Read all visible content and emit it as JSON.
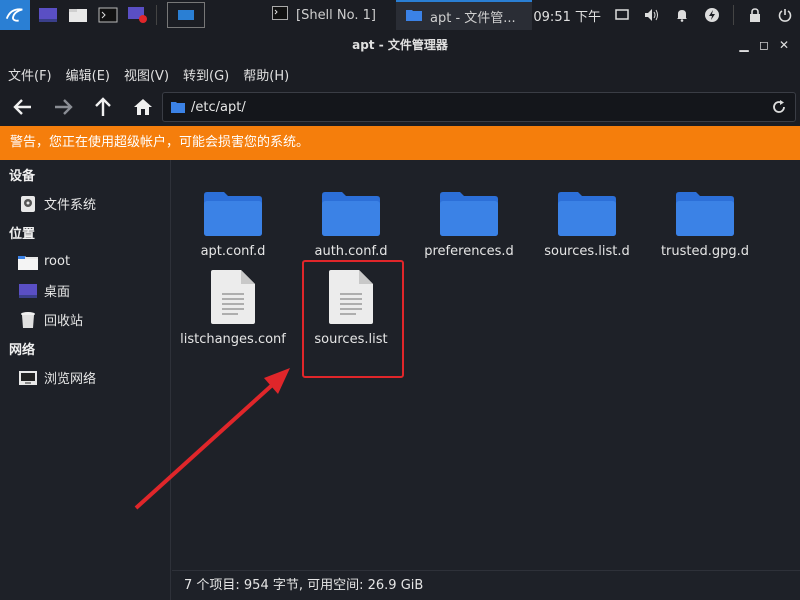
{
  "panel": {
    "tasks": [
      {
        "label": "[Shell No. 1]"
      },
      {
        "label": "apt - 文件管..."
      }
    ],
    "clock": "09:51 下午"
  },
  "window": {
    "title": "apt - 文件管理器"
  },
  "menu": [
    "文件(F)",
    "编辑(E)",
    "视图(V)",
    "转到(G)",
    "帮助(H)"
  ],
  "location": {
    "path": "/etc/apt/"
  },
  "warning": "警告，您正在使用超级帐户，可能会损害您的系统。",
  "sidebar": {
    "sections": [
      {
        "title": "设备",
        "items": [
          {
            "label": "文件系统",
            "icon": "drive-icon"
          }
        ]
      },
      {
        "title": "位置",
        "items": [
          {
            "label": "root",
            "icon": "home-folder-icon"
          },
          {
            "label": "桌面",
            "icon": "desktop-icon"
          },
          {
            "label": "回收站",
            "icon": "trash-icon"
          }
        ]
      },
      {
        "title": "网络",
        "items": [
          {
            "label": "浏览网络",
            "icon": "network-icon"
          }
        ]
      }
    ]
  },
  "files": [
    {
      "name": "apt.conf.d",
      "type": "folder"
    },
    {
      "name": "auth.conf.d",
      "type": "folder"
    },
    {
      "name": "preferences.d",
      "type": "folder"
    },
    {
      "name": "sources.list.d",
      "type": "folder"
    },
    {
      "name": "trusted.gpg.d",
      "type": "folder"
    },
    {
      "name": "listchanges.conf",
      "type": "file"
    },
    {
      "name": "sources.list",
      "type": "file",
      "highlighted": true
    }
  ],
  "status": "7 个项目: 954 字节, 可用空间: 26.9 GiB",
  "colors": {
    "accent": "#2a7fd4",
    "warning": "#f57e0c",
    "highlight": "#e0262a",
    "folder": "#3b82e6"
  }
}
